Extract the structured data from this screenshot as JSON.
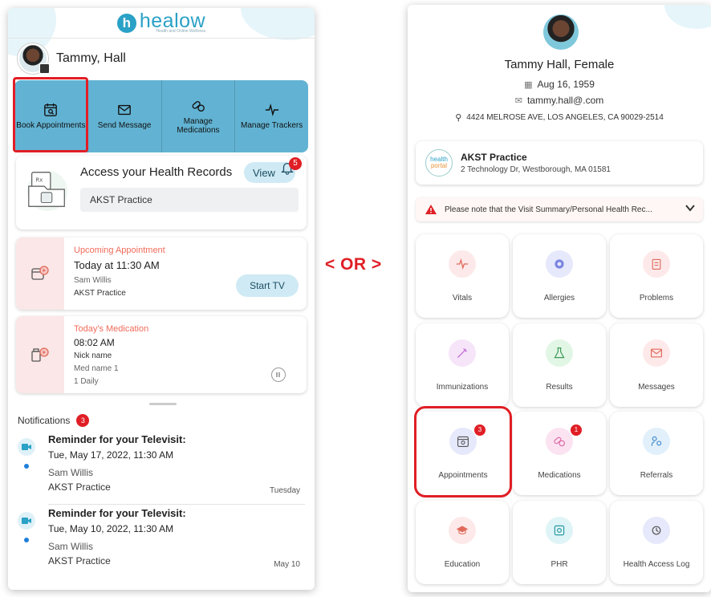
{
  "left": {
    "logo_text": "healow",
    "logo_tagline": "Health and Online Wellness",
    "profile_name": "Tammy, Hall",
    "quick_actions": [
      {
        "label": "Book Appointments",
        "icon": "calendar-search-icon"
      },
      {
        "label": "Send Message",
        "icon": "envelope-icon"
      },
      {
        "label": "Manage Medications",
        "icon": "pill-icon"
      },
      {
        "label": "Manage Trackers",
        "icon": "heartbeat-icon"
      }
    ],
    "records": {
      "title": "Access your Health Records",
      "view_label": "View",
      "bell_count": "5",
      "practice": "AKST Practice"
    },
    "appointment": {
      "section_label": "Upcoming Appointment",
      "time": "Today at 11:30 AM",
      "doctor": "Sam Willis",
      "practice": "AKST Practice",
      "button": "Start TV"
    },
    "medication": {
      "section_label": "Today's Medication",
      "time": "08:02 AM",
      "nick": "Nick name",
      "med": "Med name 1",
      "freq": "1 Daily"
    },
    "notifications": {
      "title": "Notifications",
      "count": "3",
      "items": [
        {
          "title": "Reminder for your Televisit:",
          "date": "Tue, May 17, 2022, 11:30 AM",
          "name": "Sam Willis",
          "practice": "AKST Practice",
          "when": "Tuesday"
        },
        {
          "title": "Reminder for your Televisit:",
          "date": "Tue, May 10, 2022, 11:30 AM",
          "name": "Sam Willis",
          "practice": "AKST Practice",
          "when": "May 10"
        }
      ]
    }
  },
  "or_label": "< OR >",
  "right": {
    "name": "Tammy Hall, Female",
    "dob": "Aug 16, 1959",
    "email": "tammy.hall@.com",
    "address": "4424 MELROSE AVE, LOS ANGELES, CA 90029-2514",
    "practice_name": "AKST Practice",
    "practice_address": "2 Technology Dr, Westborough, MA 01581",
    "practice_logo_top": "health",
    "practice_logo_bottom": "portal",
    "notice": "Please note that the Visit Summary/Personal Health Rec...",
    "tiles": [
      {
        "label": "Vitals",
        "icon": "heartbeat-icon",
        "color": "#fde9e9"
      },
      {
        "label": "Allergies",
        "icon": "allergy-icon",
        "color": "#e6e8fb"
      },
      {
        "label": "Problems",
        "icon": "clipboard-icon",
        "color": "#fde9e9"
      },
      {
        "label": "Immunizations",
        "icon": "syringe-icon",
        "color": "#f6e4f9"
      },
      {
        "label": "Results",
        "icon": "flask-icon",
        "color": "#e2f6e6"
      },
      {
        "label": "Messages",
        "icon": "envelope-icon",
        "color": "#fde9e9"
      },
      {
        "label": "Appointments",
        "icon": "calendar-search-icon",
        "color": "#e6e8fb",
        "badge": "3"
      },
      {
        "label": "Medications",
        "icon": "pill-icon",
        "color": "#fbe3f1",
        "badge": "1"
      },
      {
        "label": "Referrals",
        "icon": "referral-icon",
        "color": "#e1f0fb"
      },
      {
        "label": "Education",
        "icon": "graduation-cap-icon",
        "color": "#fde9e9"
      },
      {
        "label": "PHR",
        "icon": "phr-icon",
        "color": "#dff4f6"
      },
      {
        "label": "Health Access Log",
        "icon": "access-log-icon",
        "color": "#e6e8fb"
      }
    ]
  }
}
